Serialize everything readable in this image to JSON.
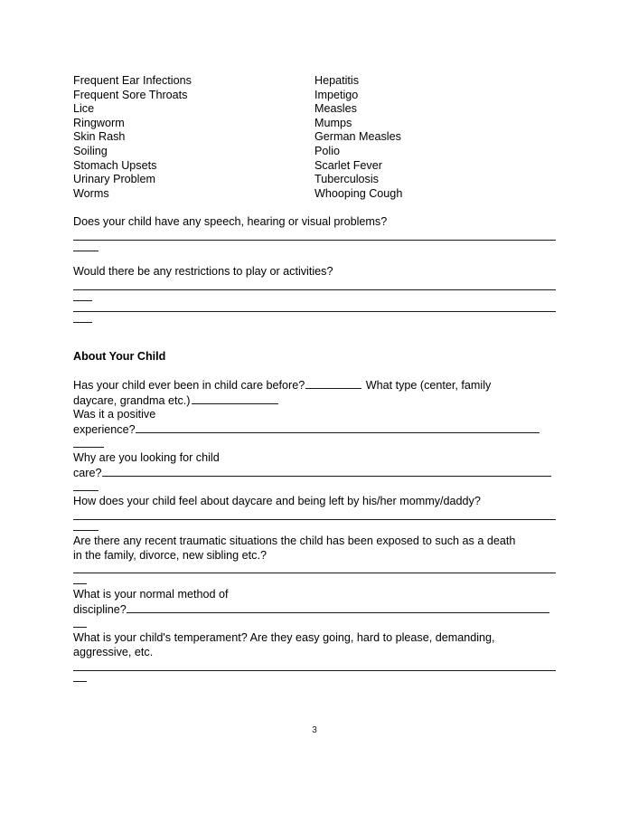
{
  "document": {
    "page_number": "3",
    "conditions": {
      "left_column": [
        "Frequent Ear Infections",
        "Frequent Sore Throats",
        "Lice",
        "Ringworm",
        "Skin Rash",
        "Soiling",
        "Stomach Upsets",
        "Urinary Problem",
        "Worms"
      ],
      "right_column": [
        "Hepatitis",
        "Impetigo",
        "Measles",
        "Mumps",
        "German Measles",
        "Polio",
        "Scarlet Fever",
        "Tuberculosis",
        "Whooping Cough"
      ]
    },
    "questions_health": [
      {
        "text": "Does your child have any speech, hearing or visual problems?"
      },
      {
        "text": "Would there be any restrictions to play or activities?"
      }
    ],
    "section": {
      "heading": "About Your Child",
      "q_childcare_before": {
        "part1": "Has your child ever been in child care before?",
        "part2": "What type (center, family",
        "part3": "daycare, grandma etc.)"
      },
      "q_positive": {
        "line1": "Was it a positive",
        "line2": "experience?"
      },
      "q_why_looking": {
        "line1": "Why are you looking for child",
        "line2": "care?"
      },
      "q_feel_about_daycare": "How does your child feel about daycare and being left by his/her mommy/daddy?",
      "q_traumatic": {
        "line1": "Are there any recent traumatic situations the child has been exposed to such as a death",
        "line2": "in the family, divorce, new sibling etc.?"
      },
      "q_discipline": {
        "line1": "What is your normal method of",
        "line2": "discipline?"
      },
      "q_temperament": {
        "line1": "What is your child's temperament? Are they easy going, hard to please, demanding,",
        "line2": "aggressive, etc."
      }
    }
  }
}
